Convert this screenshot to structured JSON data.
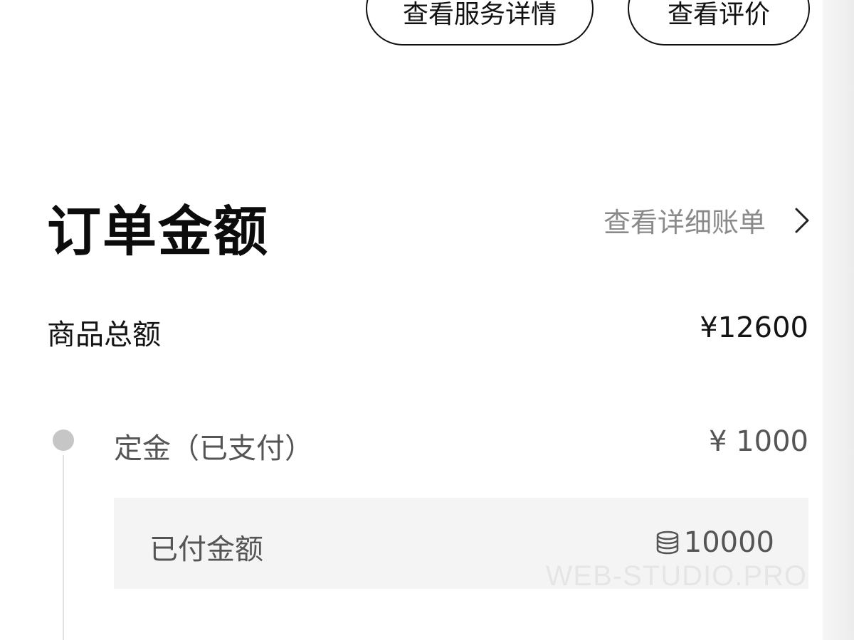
{
  "top_actions": {
    "service_details_label": "查看服务详情",
    "review_label": "查看评价"
  },
  "order_amount": {
    "title": "订单金额",
    "bill_link_label": "查看详细账单",
    "goods_total_label": "商品总额",
    "goods_total_value": "¥12600",
    "deposit_label": "定金（已支付）",
    "deposit_value": "¥ 1000",
    "paid_label": "已付金额",
    "paid_value": "10000",
    "paid_icon": "coin-stack-icon"
  },
  "watermark": "WEB-STUDIO.PRO",
  "colors": {
    "primary_text": "#111111",
    "secondary_text": "#555555",
    "muted_text": "#8a8a8a",
    "timeline_dot": "#c6c6c6",
    "paid_box_bg": "#f4f4f4"
  }
}
